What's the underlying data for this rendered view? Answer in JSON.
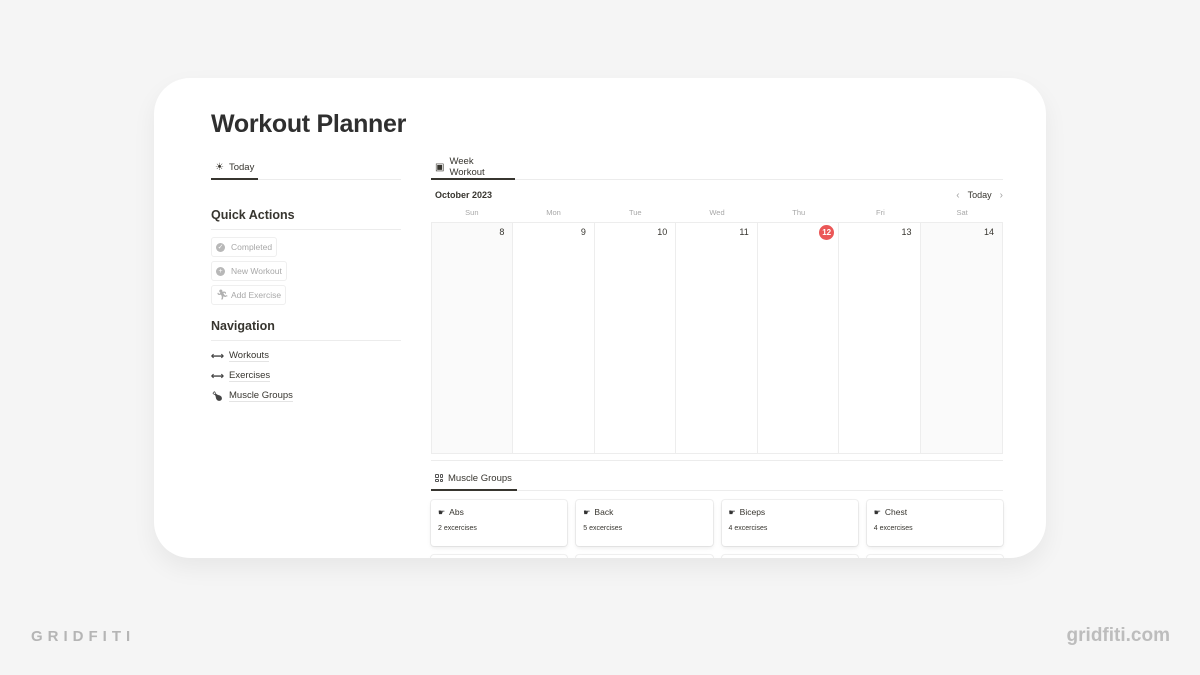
{
  "page": {
    "title": "Workout Planner"
  },
  "left_tab": {
    "icon": "sun-icon",
    "label": "Today"
  },
  "quick_actions": {
    "heading": "Quick Actions",
    "buttons": [
      {
        "icon": "check-circle-icon",
        "label": "Completed"
      },
      {
        "icon": "plus-circle-icon",
        "label": "New Workout"
      },
      {
        "icon": "running-person-icon",
        "label": "Add Exercise"
      }
    ]
  },
  "navigation": {
    "heading": "Navigation",
    "items": [
      {
        "icon": "dumbbell-icon",
        "label": "Workouts"
      },
      {
        "icon": "dumbbell-icon",
        "label": "Exercises"
      },
      {
        "icon": "drumstick-icon",
        "label": "Muscle Groups"
      }
    ]
  },
  "calendar": {
    "tab_label": "Week Workout",
    "tab_icon": "calendar-icon",
    "month": "October 2023",
    "today_button": "Today",
    "prev_icon": "chevron-left-icon",
    "next_icon": "chevron-right-icon",
    "weekdays": [
      "Sun",
      "Mon",
      "Tue",
      "Wed",
      "Thu",
      "Fri",
      "Sat"
    ],
    "days": [
      "8",
      "9",
      "10",
      "11",
      "12",
      "13",
      "14"
    ],
    "today": "12",
    "today_color": "#eb5757"
  },
  "muscle_groups": {
    "tab_label": "Muscle Groups",
    "tab_icon": "gallery-grid-icon",
    "cards": [
      {
        "icon": "flexed-arm-icon",
        "name": "Abs",
        "count": "2 excercises"
      },
      {
        "icon": "flexed-arm-icon",
        "name": "Back",
        "count": "5 excercises"
      },
      {
        "icon": "flexed-arm-icon",
        "name": "Biceps",
        "count": "4 excercises"
      },
      {
        "icon": "flexed-arm-icon",
        "name": "Chest",
        "count": "4 excercises"
      }
    ]
  },
  "branding": {
    "left": "GRIDFITI",
    "right": "gridfiti.com"
  }
}
